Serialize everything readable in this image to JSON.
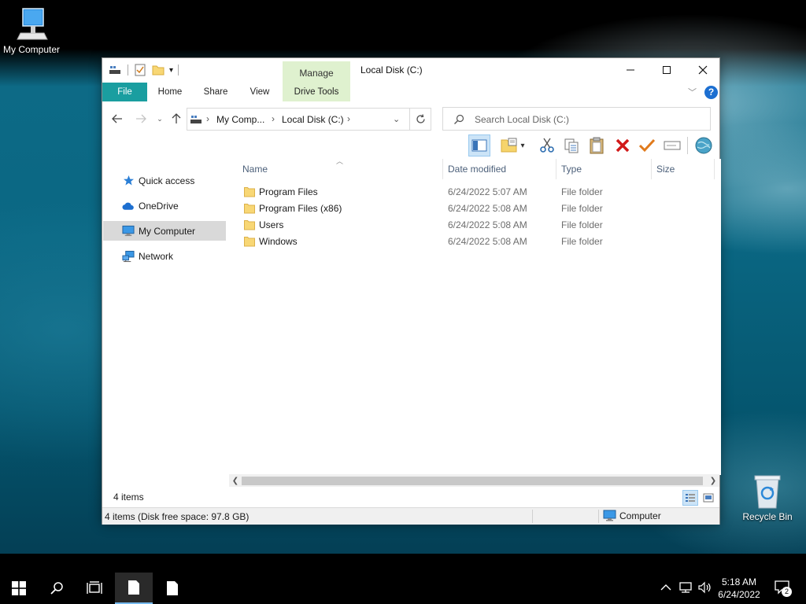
{
  "desktop": {
    "icons": [
      {
        "label": "My Computer"
      },
      {
        "label": "Recycle Bin"
      }
    ]
  },
  "window": {
    "title": "Local Disk (C:)",
    "contextual_group": "Manage",
    "tabs": [
      {
        "label": "File"
      },
      {
        "label": "Home"
      },
      {
        "label": "Share"
      },
      {
        "label": "View"
      },
      {
        "label": "Drive Tools"
      }
    ],
    "controls": {
      "minimize": "—",
      "maximize": "☐",
      "close": "✕"
    }
  },
  "address": {
    "crumbs": [
      {
        "label": "My Comp..."
      },
      {
        "label": "Local Disk (C:)"
      }
    ]
  },
  "search": {
    "placeholder": "Search Local Disk (C:)"
  },
  "nav_pane": {
    "items": [
      {
        "label": "Quick access",
        "icon": "star-icon"
      },
      {
        "label": "OneDrive",
        "icon": "cloud-icon"
      },
      {
        "label": "My Computer",
        "icon": "computer-icon",
        "selected": true
      },
      {
        "label": "Network",
        "icon": "network-icon"
      }
    ]
  },
  "columns": [
    {
      "label": "Name"
    },
    {
      "label": "Date modified"
    },
    {
      "label": "Type"
    },
    {
      "label": "Size"
    }
  ],
  "files": [
    {
      "name": "Program Files",
      "date": "6/24/2022 5:07 AM",
      "type": "File folder",
      "size": ""
    },
    {
      "name": "Program Files (x86)",
      "date": "6/24/2022 5:08 AM",
      "type": "File folder",
      "size": ""
    },
    {
      "name": "Users",
      "date": "6/24/2022 5:08 AM",
      "type": "File folder",
      "size": ""
    },
    {
      "name": "Windows",
      "date": "6/24/2022 5:08 AM",
      "type": "File folder",
      "size": ""
    }
  ],
  "item_count": "4 items",
  "status": {
    "text": "4 items (Disk free space: 97.8 GB)",
    "zone": "Computer"
  },
  "taskbar": {
    "time": "5:18 AM",
    "date": "6/24/2022",
    "notification_count": "2"
  },
  "colors": {
    "accent": "#1a9ea0",
    "manage_group": "#dff1cf",
    "selection": "#cce4f7"
  }
}
